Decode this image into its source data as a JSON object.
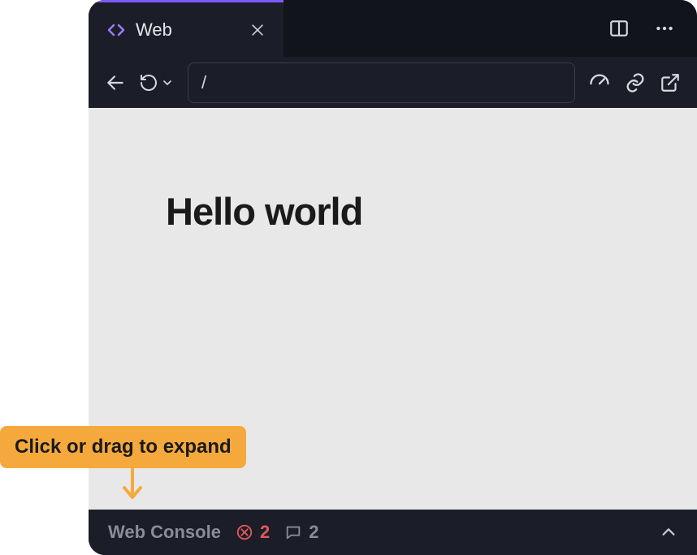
{
  "tab": {
    "title": "Web"
  },
  "toolbar": {
    "url_value": "/"
  },
  "page": {
    "heading": "Hello world"
  },
  "console": {
    "label": "Web Console",
    "error_count": "2",
    "info_count": "2"
  },
  "callout": {
    "text": "Click or drag to expand"
  }
}
